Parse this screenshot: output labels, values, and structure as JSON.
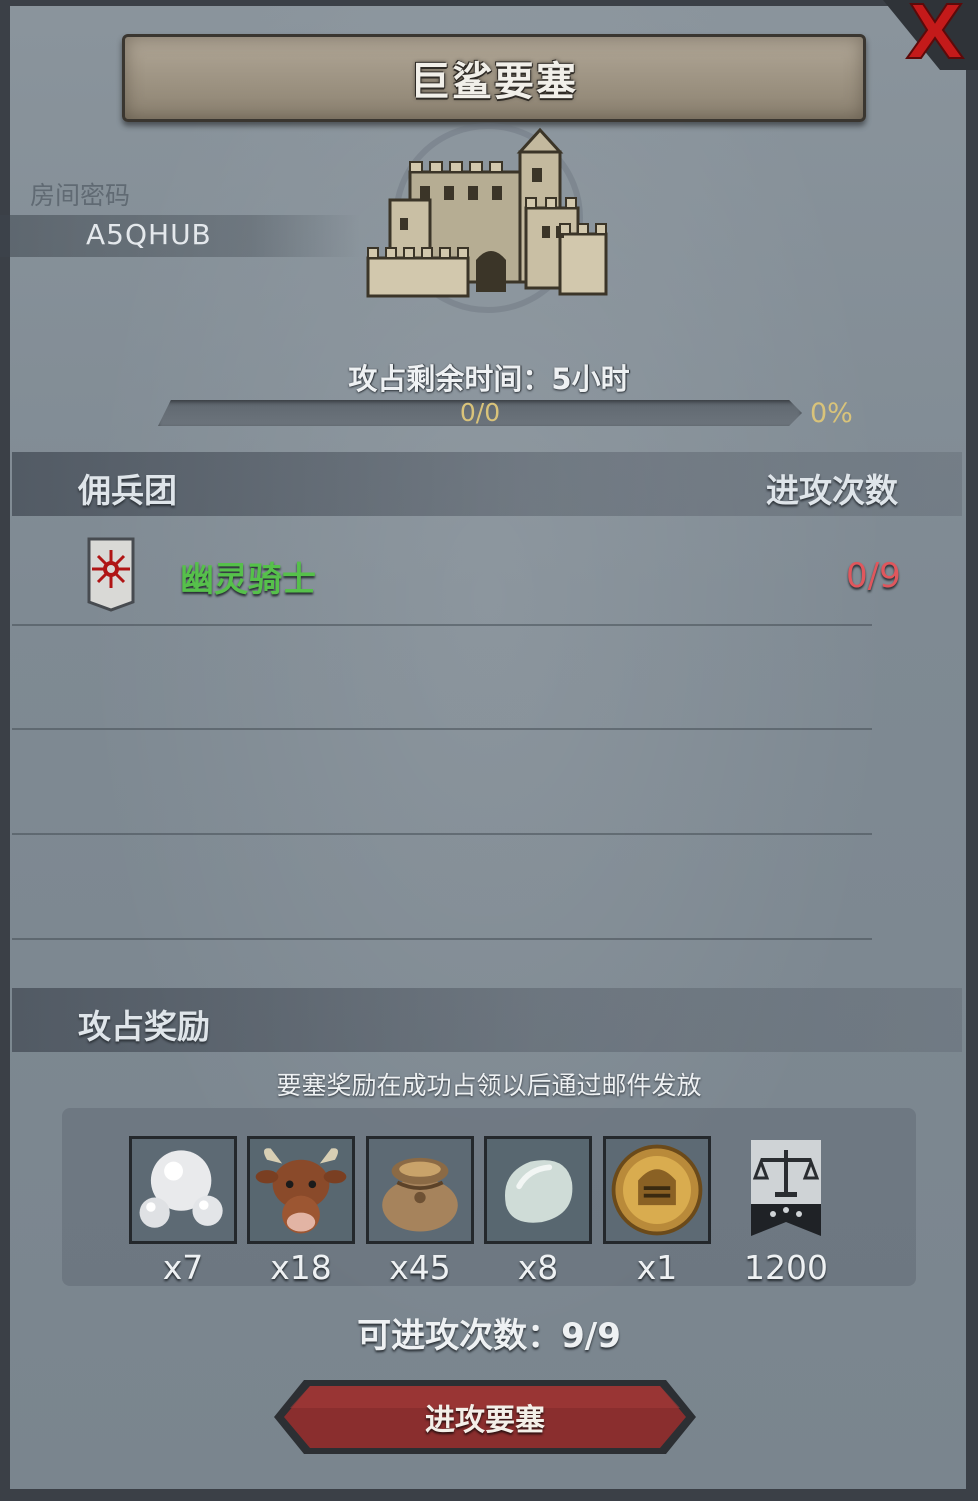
{
  "header": {
    "title": "巨鲨要塞",
    "close_icon": "close-x-icon"
  },
  "room": {
    "label": "房间密码",
    "code": "A5QHUB"
  },
  "fortress": {
    "icon": "castle-icon",
    "time_remaining": "攻占剩余时间：5小时",
    "progress_count": "0/0",
    "progress_percent": "0%",
    "progress_value": 0
  },
  "mercenaries": {
    "column_title": "佣兵团",
    "column_attacks": "进攻次数",
    "rows": [
      {
        "name": "幽灵骑士",
        "attacks": "0/9",
        "name_color": "#56c04b",
        "attacks_color": "#e0575d",
        "emblem": "red-sun-shield-icon"
      }
    ]
  },
  "rewards": {
    "title": "攻占奖励",
    "note": "要塞奖励在成功占领以后通过邮件发放",
    "items": [
      {
        "icon": "pearl-icon",
        "qty": "x7"
      },
      {
        "icon": "cow-icon",
        "qty": "x18"
      },
      {
        "icon": "grain-sack-icon",
        "qty": "x45"
      },
      {
        "icon": "stone-icon",
        "qty": "x8"
      },
      {
        "icon": "knight-medal-icon",
        "qty": "x1"
      },
      {
        "icon": "scales-banner-icon",
        "qty": "1200"
      }
    ]
  },
  "footer": {
    "attacks_left": "可进攻次数：9/9",
    "attack_button": "进攻要塞"
  }
}
